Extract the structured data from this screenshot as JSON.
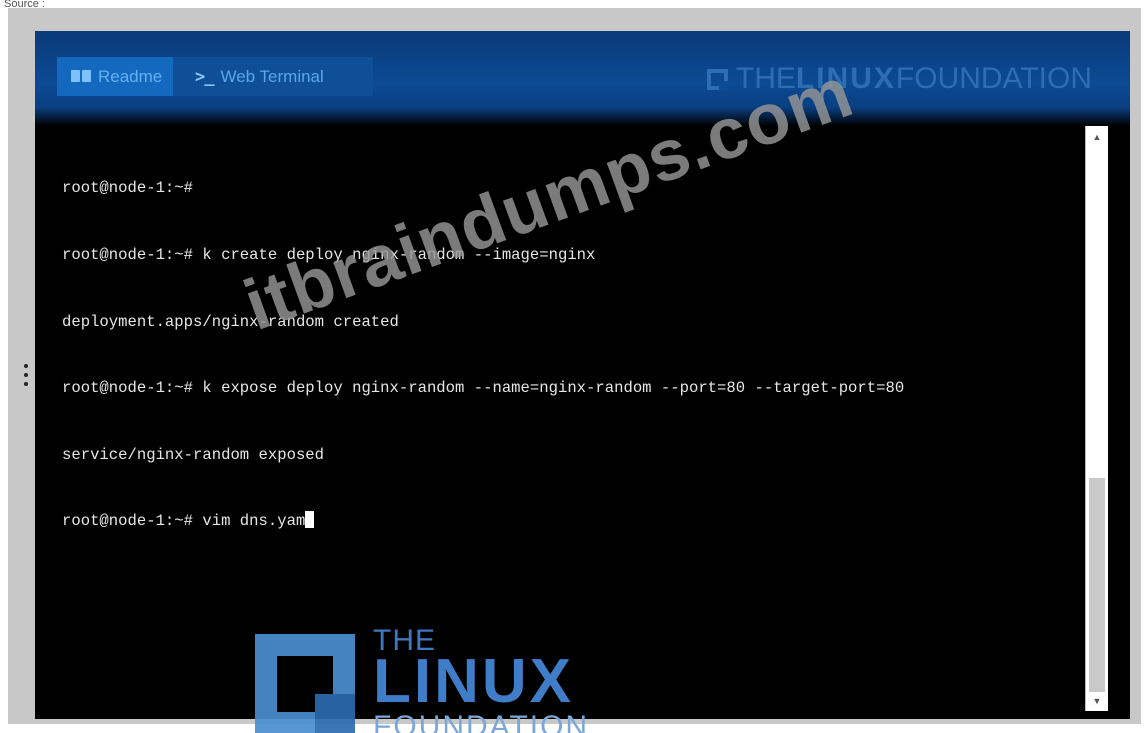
{
  "source_label": "Source :",
  "tabs": [
    {
      "label": "Readme",
      "icon": "book-icon"
    },
    {
      "label": "Web Terminal",
      "icon": "terminal-prompt-icon",
      "icon_text": ">_"
    }
  ],
  "brand": {
    "the": "THE",
    "linux": "LINUX",
    "foundation": "FOUNDATION"
  },
  "terminal": {
    "lines": [
      "root@node-1:~#",
      "root@node-1:~# k create deploy nginx-random --image=nginx",
      "deployment.apps/nginx-random created",
      "root@node-1:~# k expose deploy nginx-random --name=nginx-random --port=80 --target-port=80",
      "service/nginx-random exposed"
    ],
    "current_line": "root@node-1:~# vim dns.yam"
  },
  "watermark": "itbraindumps.com",
  "bottom_logo": {
    "the": "THE",
    "linux": "LINUX",
    "foundation": "FOUNDATION"
  },
  "colors": {
    "header": "#0c4a94",
    "tab_active": "#1469bf",
    "terminal_bg": "#000000",
    "terminal_text": "#e6e6e6"
  }
}
